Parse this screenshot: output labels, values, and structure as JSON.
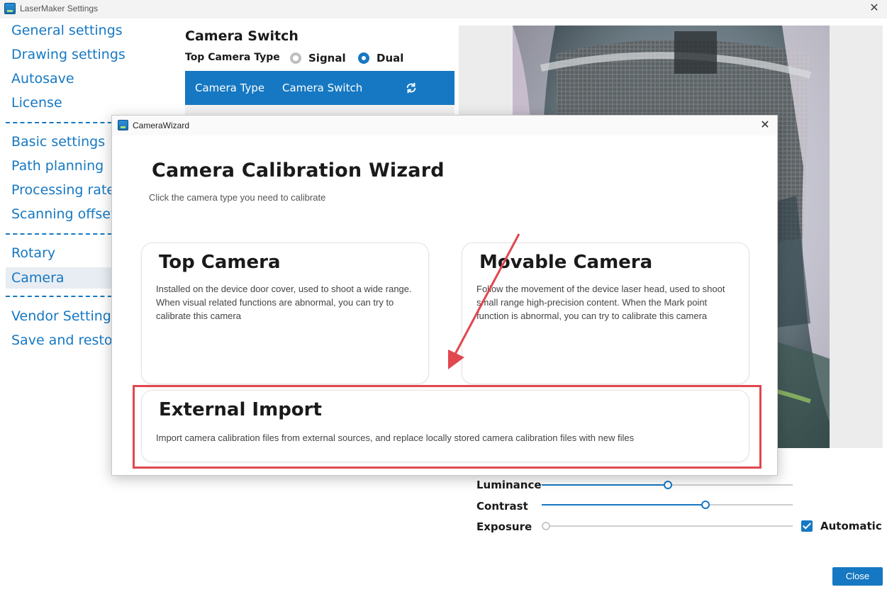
{
  "window": {
    "title": "LaserMaker Settings",
    "close_glyph": "✕"
  },
  "nav": {
    "group1": [
      "General settings",
      "Drawing settings",
      "Autosave",
      "License"
    ],
    "group2": [
      "Basic settings",
      "Path planning",
      "Processing rate",
      "Scanning offset"
    ],
    "group3": [
      "Rotary",
      "Camera"
    ],
    "group4": [
      "Vendor Settings",
      "Save and restore"
    ],
    "active": "Camera"
  },
  "camera_switch": {
    "title": "Camera Switch",
    "type_label": "Top Camera Type",
    "options": [
      {
        "label": "Signal",
        "selected": false
      },
      {
        "label": "Dual",
        "selected": true
      }
    ],
    "table_headers": [
      "Camera Type",
      "Camera Switch"
    ],
    "refresh_icon": "refresh-icon"
  },
  "controls": {
    "luminance": {
      "label": "Luminance",
      "value": 0.5
    },
    "contrast": {
      "label": "Contrast",
      "value": 0.65
    },
    "exposure": {
      "label": "Exposure",
      "value": 0.0
    },
    "automatic": {
      "label": "Automatic",
      "checked": true
    }
  },
  "footer": {
    "close_label": "Close"
  },
  "dialog": {
    "window_title": "CameraWizard",
    "title": "Camera Calibration Wizard",
    "subtitle": "Click the camera type you need to calibrate",
    "cards": [
      {
        "title": "Top Camera",
        "desc": "Installed on the device door cover, used to shoot a wide range. When visual related functions are abnormal, you can try to calibrate this camera"
      },
      {
        "title": "Movable Camera",
        "desc": "Follow the movement of the device laser head, used to shoot small range high-precision content. When the Mark point function is abnormal, you can try to calibrate this camera"
      },
      {
        "title": "External Import",
        "desc": "Import camera calibration files from external sources, and replace locally stored camera calibration files with new files"
      }
    ]
  },
  "colors": {
    "accent": "#1678c2",
    "highlight": "#e0474f"
  }
}
